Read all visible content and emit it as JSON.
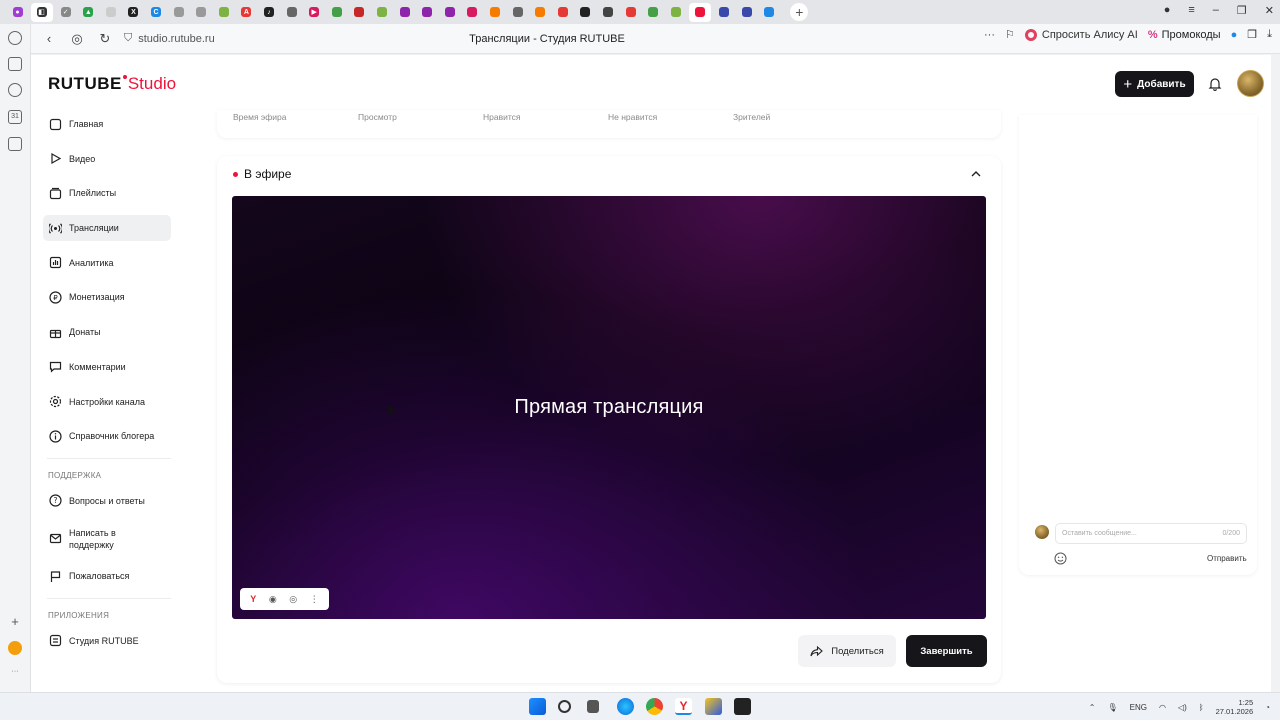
{
  "browser": {
    "url": "studio.rutube.ru",
    "page_title": "Трансляции - Студия RUTUBE",
    "alisa_label": "Спросить Алису AI",
    "promo_label": "Промокоды"
  },
  "studio": {
    "logo_main": "RUTUBE",
    "logo_sub": "Studio",
    "add_button": "Добавить",
    "nav": {
      "items": [
        {
          "label": "Главная"
        },
        {
          "label": "Видео"
        },
        {
          "label": "Плейлисты"
        },
        {
          "label": "Трансляции"
        },
        {
          "label": "Аналитика"
        },
        {
          "label": "Монетизация"
        },
        {
          "label": "Донаты"
        },
        {
          "label": "Комментарии"
        },
        {
          "label": "Настройки канала"
        },
        {
          "label": "Справочник блогера"
        }
      ],
      "support_title": "ПОДДЕРЖКА",
      "support_items": [
        {
          "label": "Вопросы и ответы"
        },
        {
          "label": "Написать в поддержку"
        },
        {
          "label": "Пожаловаться"
        }
      ],
      "apps_title": "ПРИЛОЖЕНИЯ",
      "apps_items": [
        {
          "label": "Студия RUTUBE"
        }
      ]
    },
    "metrics": [
      "Время эфира",
      "Просмотр",
      "Нравится",
      "Не нравится",
      "Зрителей"
    ],
    "live": {
      "title": "В эфире",
      "player_title": "Прямая трансляция",
      "share_button": "Поделиться",
      "finish_button": "Завершить"
    },
    "chat": {
      "placeholder": "Оставить сообщение...",
      "counter": "0/200",
      "send": "Отправить"
    }
  },
  "taskbar": {
    "lang": "ENG",
    "time": "1:25",
    "date": "27.01.2026"
  },
  "colors": {
    "accent": "#ed143b",
    "dark_button": "#16161a",
    "help_fab": "#18a7a0"
  }
}
